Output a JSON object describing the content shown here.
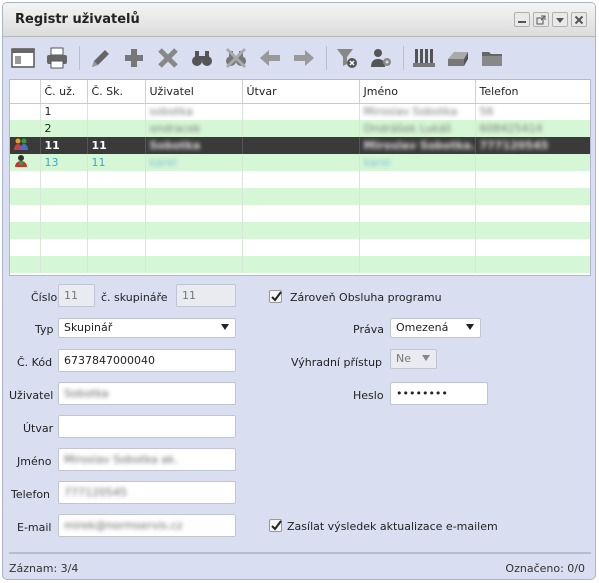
{
  "window": {
    "title": "Registr uživatelů"
  },
  "toolbar": {
    "icons": [
      "window-icon",
      "print-icon",
      "edit-icon",
      "add-icon",
      "delete-icon",
      "find-icon",
      "clear-find-icon",
      "prev-icon",
      "next-icon",
      "filter-clear-icon",
      "user-settings-icon",
      "archive-icon",
      "tray-icon",
      "folder-icon"
    ]
  },
  "grid": {
    "columns": [
      "",
      "Č. už.",
      "Č. Sk.",
      "Uživatel",
      "Útvar",
      "Jméno",
      "Telefon"
    ],
    "rows": [
      {
        "icon": "",
        "c_uz": "1",
        "c_sk": "",
        "uzivatel": "sobotka",
        "utvar": "",
        "jmeno": "Miroslav Sobotka",
        "telefon": "56"
      },
      {
        "icon": "",
        "c_uz": "2",
        "c_sk": "",
        "uzivatel": "ondracek",
        "utvar": "",
        "jmeno": "Ondrášek Lukáš",
        "telefon": "608425414"
      },
      {
        "icon": "group-icon",
        "c_uz": "11",
        "c_sk": "11",
        "uzivatel": "Sobotka",
        "utvar": "",
        "jmeno": "Miroslav Sobotka...",
        "telefon": "777120545"
      },
      {
        "icon": "user-icon",
        "c_uz": "13",
        "c_sk": "11",
        "uzivatel": "karel",
        "utvar": "",
        "jmeno": "karel",
        "telefon": ""
      }
    ]
  },
  "form": {
    "cislo_label": "Číslo",
    "cislo_value": "11",
    "skupinare_label": "č. skupináře",
    "skupinare_value": "11",
    "obsluha_label": "Zároveň Obsluha programu",
    "typ_label": "Typ",
    "typ_value": "Skupinář",
    "prava_label": "Práva",
    "prava_value": "Omezená",
    "kod_label": "Č. Kód",
    "kod_value": "6737847000040",
    "vyhradni_label": "Výhradní přístup",
    "vyhradni_value": "Ne",
    "uzivatel_label": "Uživatel",
    "uzivatel_value": "Sobotka",
    "heslo_label": "Heslo",
    "heslo_value": "••••••••",
    "utvar_label": "Útvar",
    "utvar_value": "",
    "jmeno_label": "Jméno",
    "jmeno_value": "Miroslav Sobotka ak.",
    "telefon_label": "Telefon",
    "telefon_value": "777120545",
    "email_label": "E-mail",
    "email_value": "mirek@normservis.cz",
    "zasilat_label": "Zasílat výsledek aktualizace e-mailem"
  },
  "status": {
    "zaznam": "Záznam: 3/4",
    "oznaceno": "Označeno: 0/0"
  }
}
